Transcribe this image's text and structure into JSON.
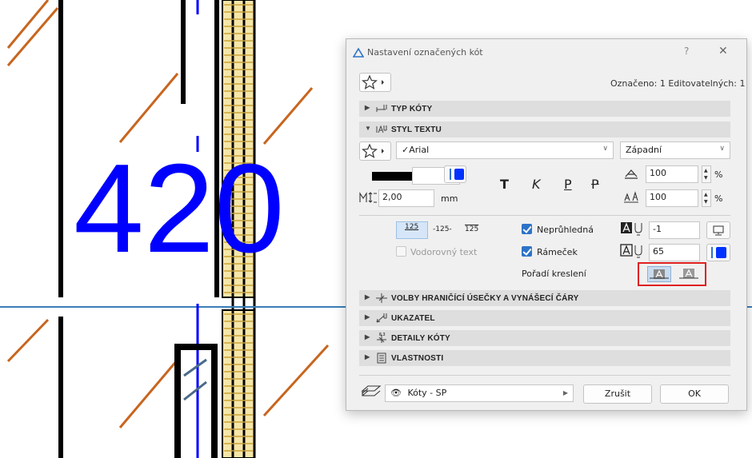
{
  "canvas": {
    "big_number": "420"
  },
  "dialog": {
    "title": "Nastavení označených kót",
    "help": "?",
    "close": "✕",
    "selection_info": "Označeno: 1 Editovatelných: 1",
    "sections": {
      "dim_type": "TYP KÓTY",
      "text_style": "STYL TEXTU",
      "witness": "VOLBY HRANIČÍCÍ ÚSEČKY A VYNÁŠECÍ ČÁRY",
      "marker": "UKAZATEL",
      "details": "DETAILY KÓTY",
      "properties": "VLASTNOSTI"
    },
    "font": {
      "name": "Arial",
      "script": "Západní"
    },
    "size": {
      "value": "2,00",
      "unit": "mm"
    },
    "styles": {
      "bold": "T",
      "italic": "K",
      "underline": "P",
      "strike": "P"
    },
    "scale_width": {
      "value": "100",
      "unit": "%"
    },
    "scale_spacing": {
      "value": "100",
      "unit": "%"
    },
    "position_labels": {
      "above": "125",
      "inline": "-125-",
      "below": "125"
    },
    "opaque": {
      "label": "Neprůhledná",
      "checked": true
    },
    "frame": {
      "label": "Rámeček",
      "checked": true
    },
    "horizontal_text": {
      "label": "Vodorovný text",
      "checked": false
    },
    "pen_fill": "-1",
    "pen_frame": "65",
    "draw_order_label": "Pořadí kreslení",
    "layer": "Kóty - SP",
    "cancel": "Zrušit",
    "ok": "OK"
  },
  "colors": {
    "accent": "#2c73c8",
    "blue_pen": "#0000ff",
    "highlight": "#e02020"
  }
}
